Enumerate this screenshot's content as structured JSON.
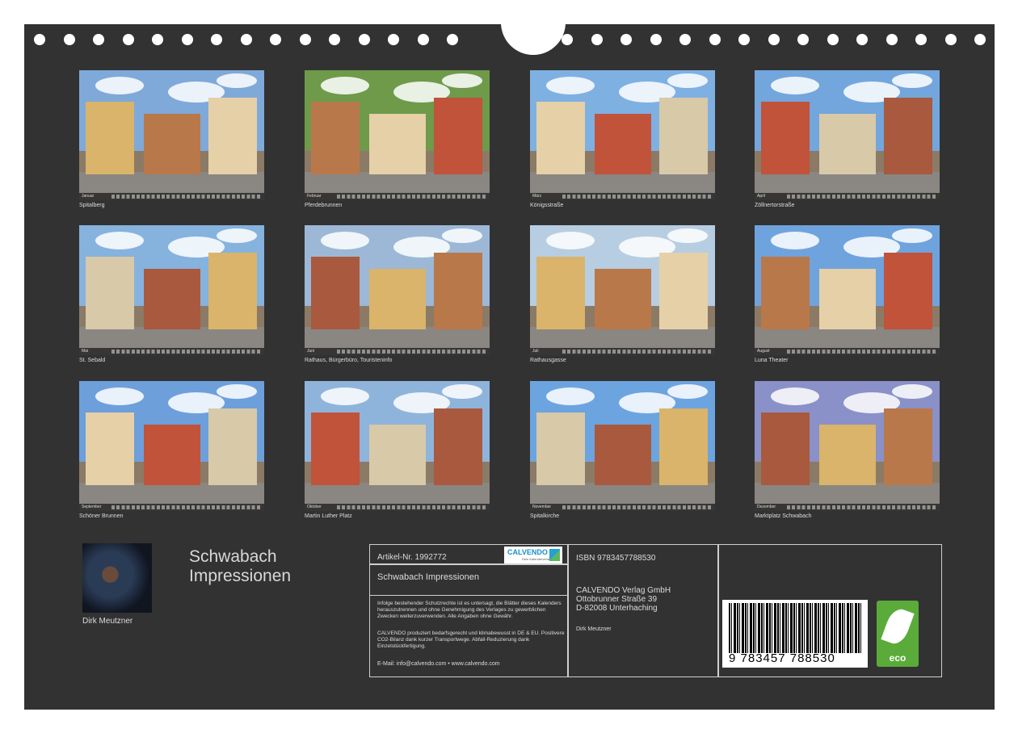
{
  "calendar": {
    "title_line1": "Schwabach",
    "title_line2": "Impressionen",
    "author": "Dirk Meutzner"
  },
  "months": [
    {
      "caption": "Spitalberg",
      "month_label": "Januar",
      "sky": "#7fa9d8"
    },
    {
      "caption": "Pferdebrunnen",
      "month_label": "Februar",
      "sky": "#6e9a4a"
    },
    {
      "caption": "Königsstraße",
      "month_label": "März",
      "sky": "#7fb0e2"
    },
    {
      "caption": "Zöllnertorstraße",
      "month_label": "April",
      "sky": "#73a6dc"
    },
    {
      "caption": "St. Sebald",
      "month_label": "Mai",
      "sky": "#86b2de"
    },
    {
      "caption": "Rathaus, Bürgerbüro, Touristeninfo",
      "month_label": "Juni",
      "sky": "#9cb8d6"
    },
    {
      "caption": "Rathausgasse",
      "month_label": "Juli",
      "sky": "#b7cde2"
    },
    {
      "caption": "Luna Theater",
      "month_label": "August",
      "sky": "#6fa3dd"
    },
    {
      "caption": "Schöner Brunnen",
      "month_label": "September",
      "sky": "#6d9fdb"
    },
    {
      "caption": "Martin Luther Platz",
      "month_label": "Oktober",
      "sky": "#8fb4dc"
    },
    {
      "caption": "Spitalkirche",
      "month_label": "November",
      "sky": "#6ca4e0"
    },
    {
      "caption": "Marktplatz Schwabach",
      "month_label": "Dezember",
      "sky": "#8a90c8"
    }
  ],
  "info": {
    "article": "Artikel-Nr. 1992772",
    "product_title": "Schwabach Impressionen",
    "legal": "Infolge bestehender Schutzrechte ist es untersagt, die Blätter dieses Kalenders herauszutrennen und ohne Genehmigung des Verlages zu gewerblichen Zwecken weiterzuverwenden. Alle Angaben ohne Gewähr.",
    "eco_note": "CALVENDO produziert bedarfsgerecht und klimabewusst in DE & EU. Positivere CO2-Bilanz dank kurzer Transportwege. Abfall-Reduzierung dank Einzelstückfertigung.",
    "contact": "E-Mail: info@calvendo.com • www.calvendo.com",
    "isbn": "ISBN 9783457788530",
    "publisher_name": "CALVENDO Verlag GmbH",
    "publisher_street": "Ottobrunner Straße 39",
    "publisher_city": "D-82008 Unterhaching",
    "author_small": "Dirk Meutzner",
    "logo_word": "CALVENDO",
    "logo_sub": "Dein Kalenderverlag",
    "barcode_digits": "9 783457 788530",
    "eco_label": "eco"
  }
}
